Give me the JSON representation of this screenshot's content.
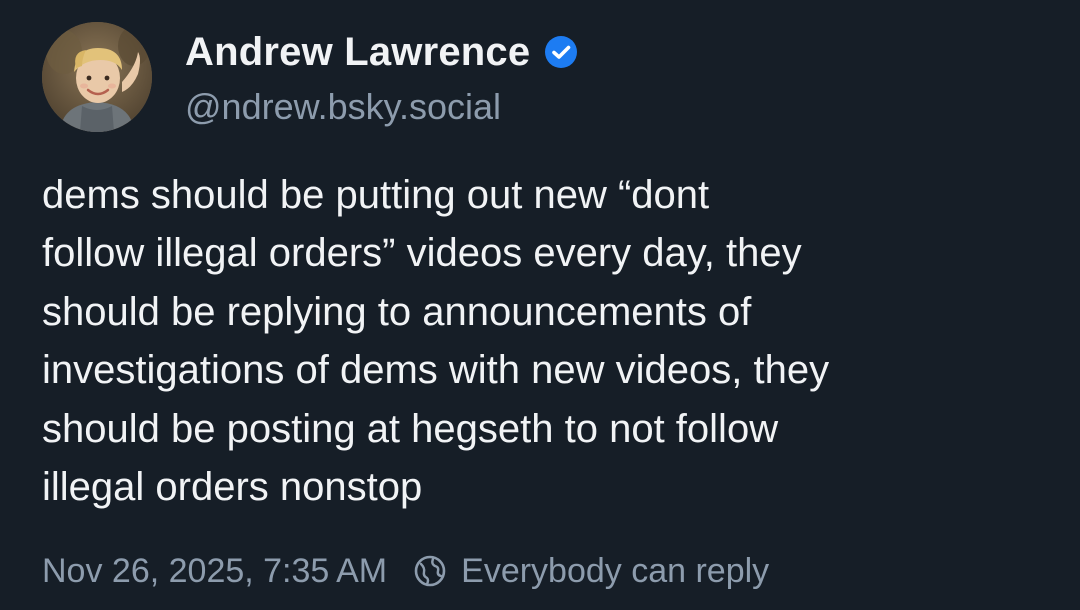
{
  "author": {
    "display_name": "Andrew Lawrence",
    "handle": "@ndrew.bsky.social",
    "verified_icon": "verified-check-icon",
    "avatar_icon": "avatar-photo-child"
  },
  "post": {
    "text_lines": [
      "dems should be putting out new “dont",
      "follow illegal orders” videos every day, they",
      "should be replying to announcements of",
      "investigations of dems with new videos, they",
      "should be posting at hegseth to not follow",
      "illegal orders nonstop"
    ]
  },
  "meta": {
    "timestamp": "Nov 26, 2025, 7:35 AM",
    "reply_icon": "globe-icon",
    "reply_setting": "Everybody can reply"
  },
  "colors": {
    "background": "#161e27",
    "text": "#f1f3f5",
    "muted": "#8d9cad",
    "verified": "#1d7cf2"
  }
}
